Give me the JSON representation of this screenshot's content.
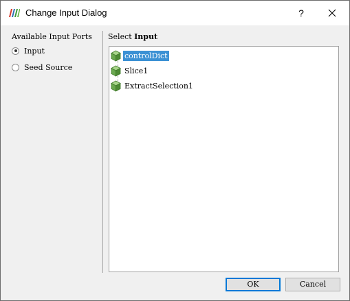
{
  "window": {
    "title": "Change Input Dialog",
    "help_symbol": "?"
  },
  "ports": {
    "label": "Available Input Ports",
    "options": [
      {
        "label": "Input",
        "checked": true
      },
      {
        "label": "Seed Source",
        "checked": false
      }
    ]
  },
  "select": {
    "prefix": "Select",
    "target": "Input"
  },
  "tree": {
    "items": [
      {
        "label": "controlDict",
        "selected": true
      },
      {
        "label": "Slice1",
        "selected": false
      },
      {
        "label": "ExtractSelection1",
        "selected": false
      }
    ]
  },
  "buttons": {
    "ok": "OK",
    "cancel": "Cancel"
  },
  "colors": {
    "selection": "#3b91d4",
    "default_button_border": "#0078d7",
    "cube_green": "#6aa84f"
  },
  "icons": {
    "app": "paraview-logo-icon",
    "pipeline_item": "green-cube-icon"
  }
}
